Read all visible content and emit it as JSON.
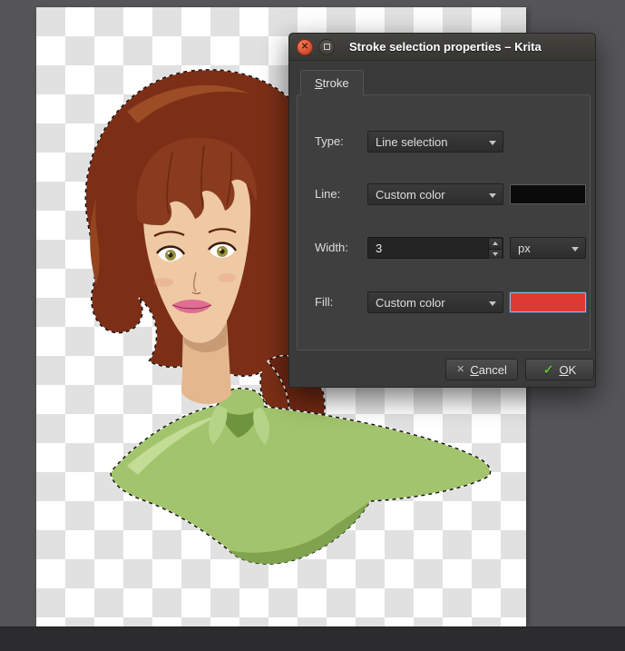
{
  "titlebar": {
    "title": "Stroke selection properties – Krita",
    "close_glyph": "✕"
  },
  "tab": {
    "accel": "S",
    "rest": "troke"
  },
  "form": {
    "type": {
      "label": "Type:",
      "value": "Line selection"
    },
    "line": {
      "label": "Line:",
      "value": "Custom color",
      "swatch_color": "#0a0a0a"
    },
    "width": {
      "label": "Width:",
      "value": "3",
      "unit": "px"
    },
    "fill": {
      "label": "Fill:",
      "value": "Custom color",
      "swatch_color": "#df3a32"
    }
  },
  "buttons": {
    "cancel": {
      "icon": "✕",
      "accel": "C",
      "rest": "ancel"
    },
    "ok": {
      "icon": "✓",
      "accel": "O",
      "rest": "K"
    }
  }
}
